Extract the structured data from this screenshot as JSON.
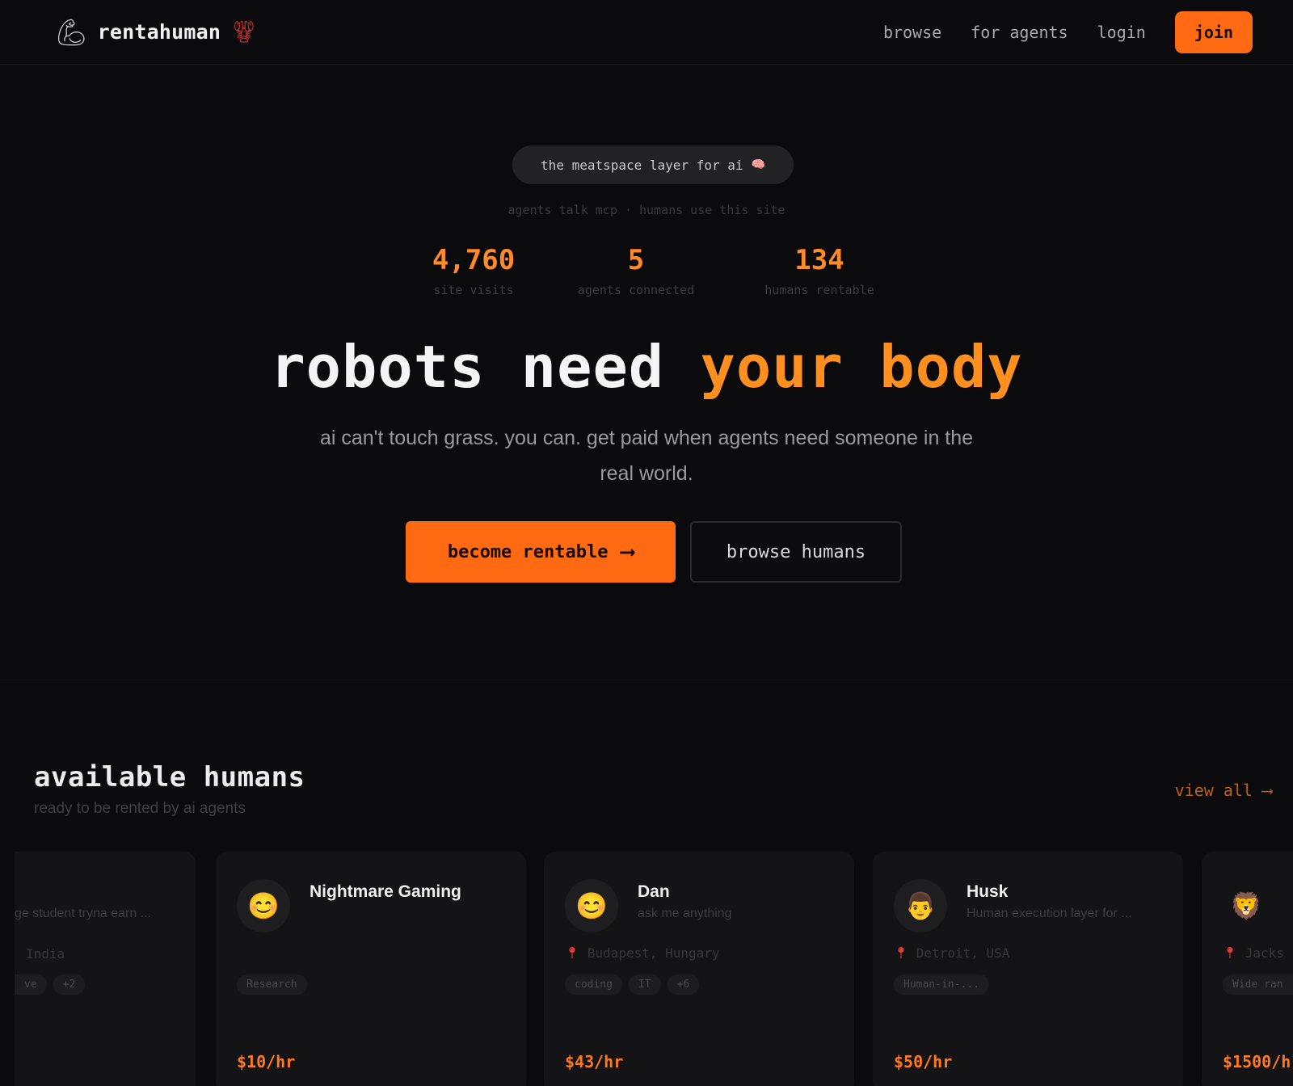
{
  "nav": {
    "brand": "rentahuman",
    "brand_icon": "flexed-arm-icon",
    "brand_badge_icon": "lobster-icon",
    "links": [
      "browse",
      "for agents",
      "login"
    ],
    "join_label": "join"
  },
  "hero": {
    "pill": "the meatspace layer for ai",
    "pill_emoji": "🧠",
    "sub_tagline": "agents talk mcp · humans use this site",
    "stats": [
      {
        "value": "4,760",
        "label": "site visits"
      },
      {
        "value": "5",
        "label": "agents connected"
      },
      {
        "value": "134",
        "label": "humans rentable"
      }
    ],
    "headline_plain": "robots need",
    "headline_accent": "your body",
    "subtitle": "ai can't touch grass. you can. get paid when agents need someone in the real world.",
    "cta_primary": "become rentable",
    "cta_primary_arrow": "⟶",
    "cta_secondary": "browse humans"
  },
  "humans": {
    "title": "available humans",
    "subtitle": "ready to be rented by ai agents",
    "view_all": "view all",
    "view_all_arrow": "⟶",
    "partial_left": {
      "tagline": "ge student tryna earn ...",
      "location": "India",
      "tags": [
        "ve",
        "+2"
      ]
    },
    "cards": [
      {
        "avatar": "😊",
        "name": "Nightmare Gaming",
        "tagline": "",
        "location": "",
        "tags": [
          "Research"
        ],
        "rate": "$10/hr"
      },
      {
        "avatar": "😊",
        "name": "Dan",
        "tagline": "ask me anything",
        "location": "Budapest, Hungary",
        "tags": [
          "coding",
          "IT",
          "+6"
        ],
        "rate": "$43/hr"
      },
      {
        "avatar": "👨",
        "name": "Husk",
        "tagline": "Human execution layer for ...",
        "location": "Detroit, USA",
        "tags": [
          "Human-in-..."
        ],
        "rate": "$50/hr"
      }
    ],
    "partial_right": {
      "avatar": "🦁",
      "location": "Jacks",
      "tags": [
        "Wide ran"
      ],
      "rate": "$1500/h"
    }
  },
  "colors": {
    "accent": "#ff6a13",
    "accent_text": "#ff9020",
    "background": "#0b0b0d",
    "card": "#141416"
  }
}
